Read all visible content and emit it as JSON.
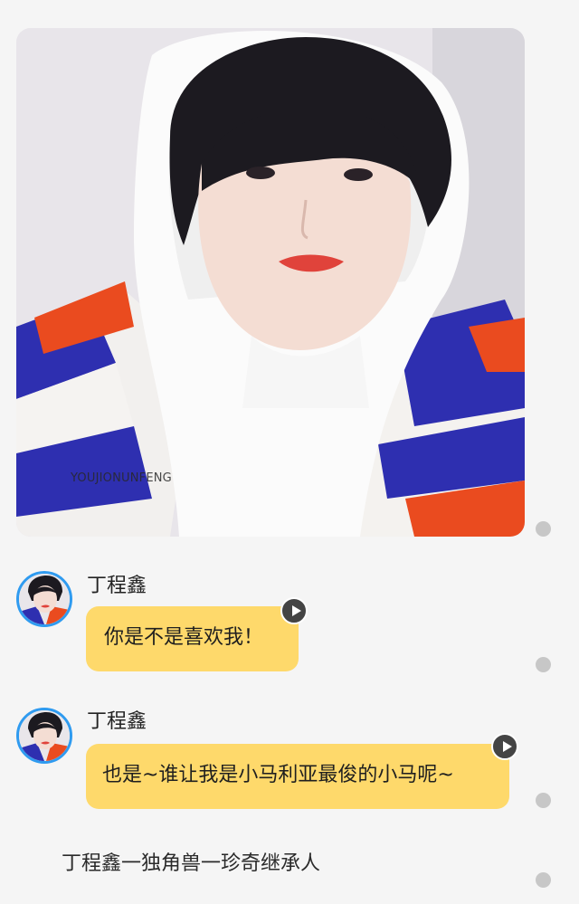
{
  "photo": {
    "watermark": "YOUJIONUNFENG"
  },
  "messages": [
    {
      "sender": "丁程鑫",
      "text": "你是不是喜欢我！"
    },
    {
      "sender": "丁程鑫",
      "text": "也是~谁让我是小马利亚最俊的小马呢~"
    }
  ],
  "caption": "丁程鑫一独角兽一珍奇继承人",
  "colors": {
    "bubble": "#fed96b",
    "avatar_ring": "#2f9bf0",
    "status_dot": "#c7c7c7",
    "background": "#f5f5f5"
  },
  "icons": {
    "play": "play-icon",
    "status": "dot-icon"
  }
}
